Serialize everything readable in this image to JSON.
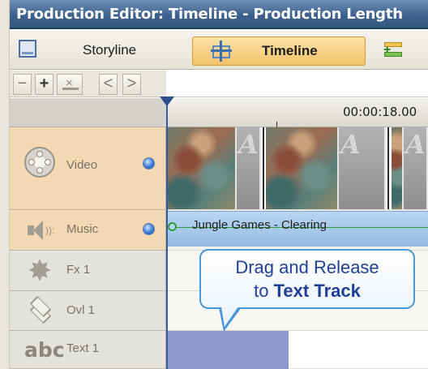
{
  "window": {
    "title": "Production Editor: Timeline - Production Length"
  },
  "modes": {
    "storyline_label": "Storyline",
    "timeline_label": "Timeline",
    "active": "Timeline"
  },
  "toolbar": {
    "minus": "−",
    "plus": "+",
    "delete_icon": "×",
    "prev": "<",
    "next": ">"
  },
  "ruler": {
    "time": "00:00:18.00"
  },
  "tracks": [
    {
      "label": "Video",
      "icon": "film-reel-icon",
      "visible": true
    },
    {
      "label": "Music",
      "icon": "speaker-icon",
      "visible": true
    },
    {
      "label": "Fx 1",
      "icon": "fx-star-icon"
    },
    {
      "label": "Ovl 1",
      "icon": "overlay-layers-icon"
    },
    {
      "label": "Text 1",
      "icon": "abc-text-icon",
      "icon_text": "abc"
    }
  ],
  "video_track": {
    "transition_letter": "A"
  },
  "music_clip": {
    "title": "Jungle Games - Clearing"
  },
  "callout": {
    "line1": "Drag and Release",
    "line2_prefix": "to ",
    "line2_bold": "Text Track"
  },
  "colors": {
    "title_bar": "#3e628f",
    "active_tab": "#f2c26a",
    "track_header_active": "#f2d9b3",
    "music_clip": "#97bde4",
    "text_drop_zone": "#8b99cf",
    "callout_border": "#4a97d8",
    "callout_text": "#1f3f97"
  }
}
